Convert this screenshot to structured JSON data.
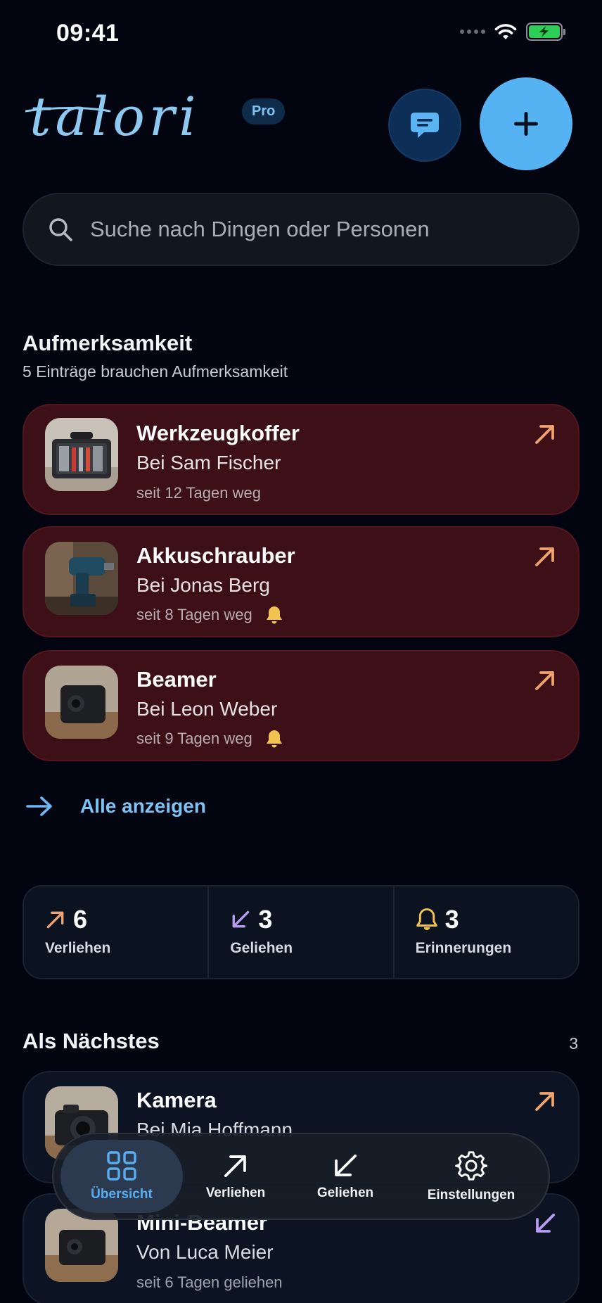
{
  "status_bar": {
    "time": "09:41"
  },
  "header": {
    "logo_text": "talori",
    "badge": "Pro"
  },
  "search": {
    "placeholder": "Suche nach Dingen oder Personen"
  },
  "attention": {
    "title": "Aufmerksamkeit",
    "subtitle": "5 Einträge brauchen Aufmerksamkeit",
    "items": [
      {
        "title": "Werkzeugkoffer",
        "person": "Bei Sam Fischer",
        "meta": "seit 12 Tagen weg",
        "reminder": false,
        "direction": "verliehen",
        "image": "toolbox"
      },
      {
        "title": "Akkuschrauber",
        "person": "Bei Jonas Berg",
        "meta": "seit 8 Tagen weg",
        "reminder": true,
        "direction": "verliehen",
        "image": "drill"
      },
      {
        "title": "Beamer",
        "person": "Bei Leon Weber",
        "meta": "seit 9 Tagen weg",
        "reminder": true,
        "direction": "verliehen",
        "image": "projector"
      }
    ],
    "show_all": "Alle anzeigen"
  },
  "stats": [
    {
      "value": "6",
      "label": "Verliehen",
      "icon": "arrow-up-right-icon",
      "color": "#f0a36e"
    },
    {
      "value": "3",
      "label": "Geliehen",
      "icon": "arrow-down-left-icon",
      "color": "#b79cf0"
    },
    {
      "value": "3",
      "label": "Erinnerungen",
      "icon": "bell-icon",
      "color": "#f3c34f"
    }
  ],
  "next": {
    "title": "Als Nächstes",
    "count": "3",
    "items": [
      {
        "title": "Kamera",
        "person": "Bei Mia Hoffmann",
        "meta": "",
        "direction": "verliehen",
        "image": "camera"
      },
      {
        "title": "Mini-Beamer",
        "person": "Von Luca Meier",
        "meta": "seit 6 Tagen geliehen",
        "direction": "geliehen",
        "image": "mini-projector"
      }
    ]
  },
  "tabs": [
    {
      "label": "Übersicht",
      "icon": "grid-icon",
      "active": true
    },
    {
      "label": "Verliehen",
      "icon": "arrow-up-right-icon",
      "active": false
    },
    {
      "label": "Geliehen",
      "icon": "arrow-down-left-icon",
      "active": false
    },
    {
      "label": "Einstellungen",
      "icon": "gear-icon",
      "active": false
    }
  ],
  "colors": {
    "background": "#020510",
    "accent": "#55b3f3",
    "lent_arrow": "#f0a36e",
    "borrowed_arrow": "#b79cf0",
    "bell": "#f3c34f",
    "attention_card": "#3d0f17"
  }
}
